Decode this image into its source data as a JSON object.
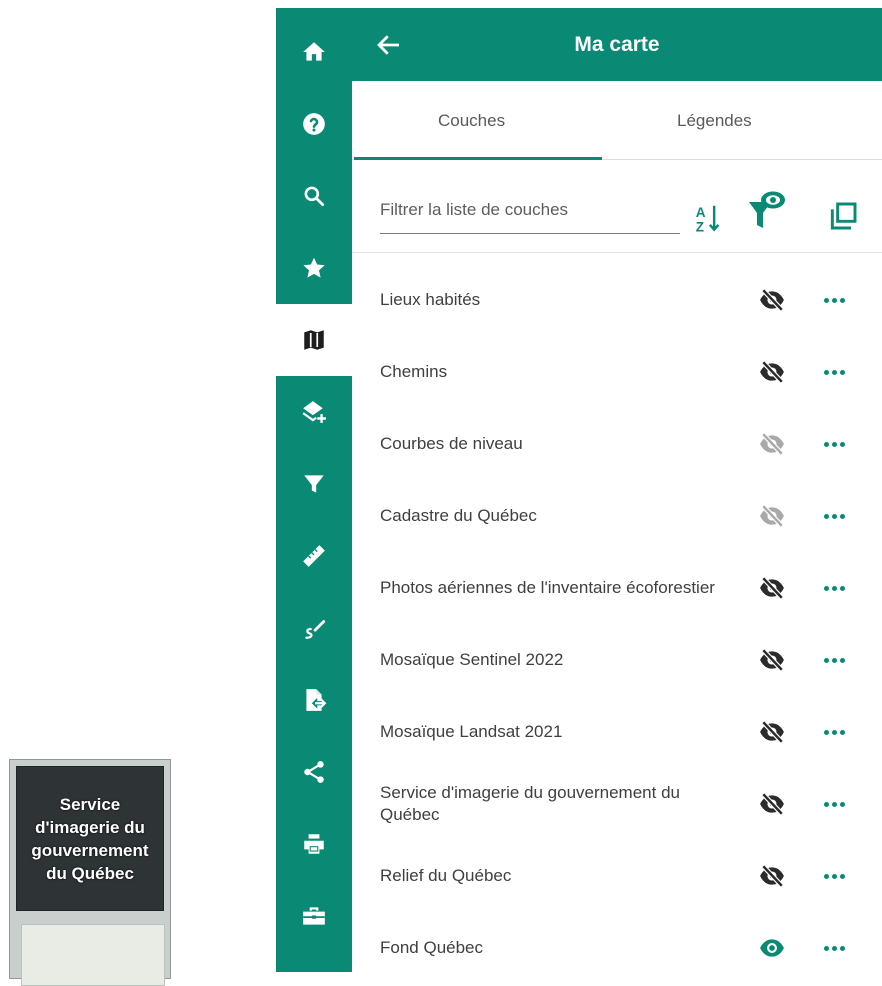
{
  "basemap_thumbnail": {
    "label": "Service d'imagerie du gouvernement du Québec"
  },
  "sidebar": {
    "items": [
      {
        "icon": "home-icon"
      },
      {
        "icon": "help-icon"
      },
      {
        "icon": "search-icon"
      },
      {
        "icon": "star-icon"
      },
      {
        "icon": "map-icon",
        "active": true
      },
      {
        "icon": "add-layer-icon"
      },
      {
        "icon": "filter-icon"
      },
      {
        "icon": "ruler-icon"
      },
      {
        "icon": "draw-icon"
      },
      {
        "icon": "export-file-icon"
      },
      {
        "icon": "share-icon"
      },
      {
        "icon": "print-icon"
      },
      {
        "icon": "toolbox-icon"
      }
    ]
  },
  "panel": {
    "title": "Ma carte",
    "tabs": [
      {
        "label": "Couches",
        "active": true
      },
      {
        "label": "Légendes",
        "active": false
      }
    ],
    "filter": {
      "placeholder": "Filtrer la liste de couches"
    }
  },
  "layers": [
    {
      "name": "Lieux habités",
      "visibility": "hidden"
    },
    {
      "name": "Chemins",
      "visibility": "hidden"
    },
    {
      "name": "Courbes de niveau",
      "visibility": "disabled"
    },
    {
      "name": "Cadastre du Québec",
      "visibility": "disabled"
    },
    {
      "name": "Photos aériennes de l'inventaire écoforestier",
      "visibility": "hidden"
    },
    {
      "name": "Mosaïque Sentinel 2022",
      "visibility": "hidden"
    },
    {
      "name": "Mosaïque Landsat 2021",
      "visibility": "hidden"
    },
    {
      "name": "Service d'imagerie du gouvernement du Québec",
      "visibility": "hidden"
    },
    {
      "name": "Relief du Québec",
      "visibility": "hidden"
    },
    {
      "name": "Fond Québec",
      "visibility": "visible"
    }
  ],
  "colors": {
    "brand": "#0a8a74",
    "icon_dark": "#2b2b2b",
    "icon_disabled": "#a9a9a9"
  }
}
